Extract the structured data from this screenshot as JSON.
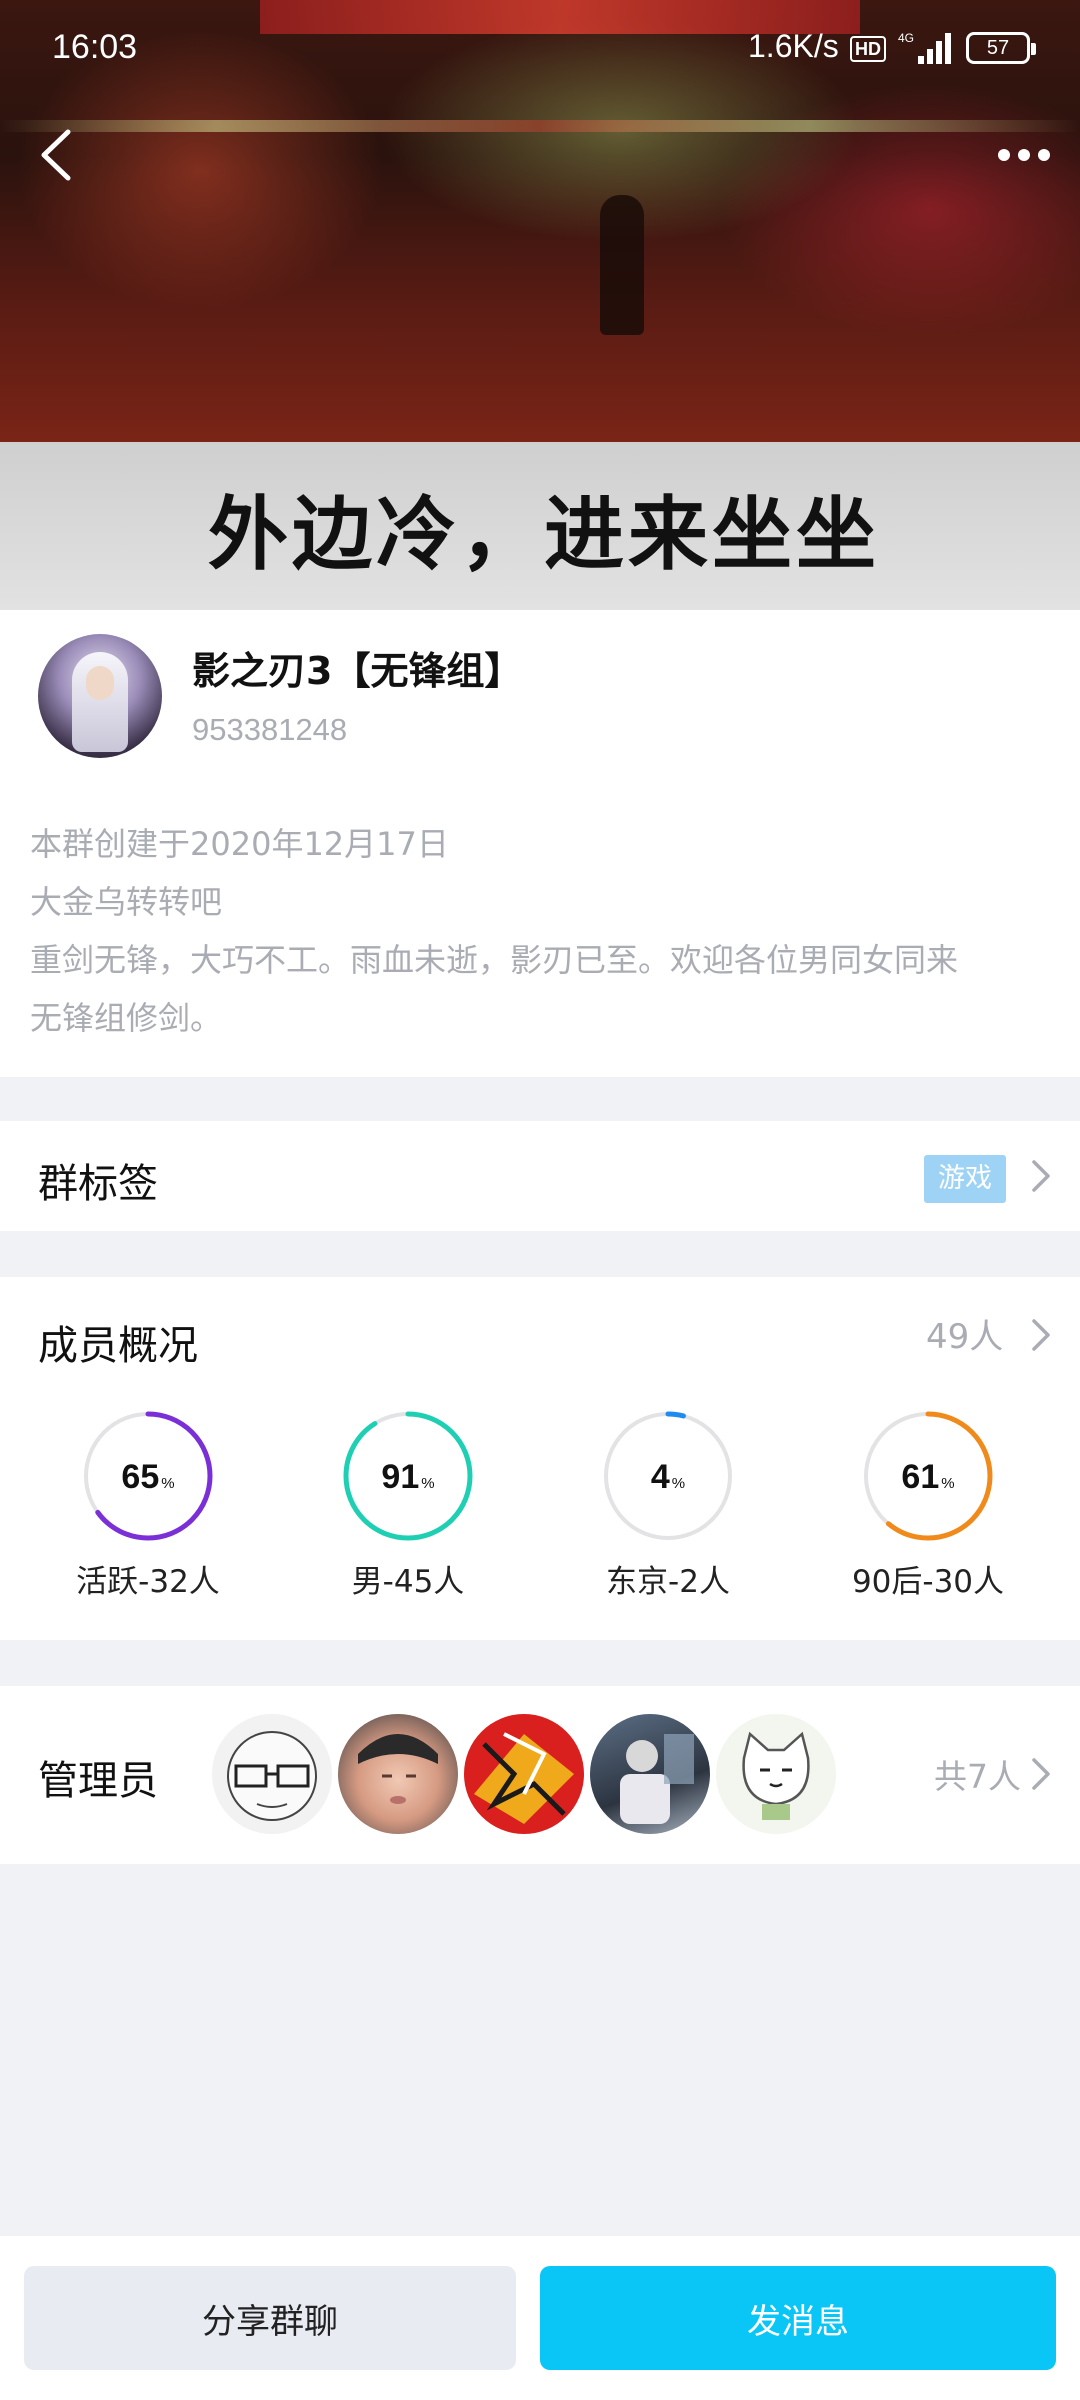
{
  "status_bar": {
    "time": "16:03",
    "net_speed": "1.6K/s",
    "hd_badge": "HD",
    "network_type": "4G",
    "battery": "57"
  },
  "banner": {
    "caption": "外边冷，进来坐坐"
  },
  "group": {
    "name": "影之刃3【无锋组】",
    "id": "953381248",
    "description_lines": [
      "本群创建于2020年12月17日",
      "大金乌转转吧",
      "重剑无锋，大巧不工。雨血未逝，影刃已至。欢迎各位男同女同来",
      "无锋组修剑。"
    ]
  },
  "tags": {
    "title": "群标签",
    "tag": "游戏"
  },
  "members": {
    "title": "成员概况",
    "count": "49人",
    "stats": [
      {
        "value": "65",
        "percent_sign": "%",
        "fraction": 0.65,
        "label": "活跃-32人",
        "color": "#7b2fd6"
      },
      {
        "value": "91",
        "percent_sign": "%",
        "fraction": 0.91,
        "label": "男-45人",
        "color": "#1fcfb3"
      },
      {
        "value": "4",
        "percent_sign": "%",
        "fraction": 0.04,
        "label": "东京-2人",
        "color": "#1f8bf0"
      },
      {
        "value": "61",
        "percent_sign": "%",
        "fraction": 0.61,
        "label": "90后-30人",
        "color": "#f08a1a"
      }
    ]
  },
  "admins": {
    "title": "管理员",
    "total": "共7人",
    "avatars": [
      "glasses-face-avatar",
      "baby-photo-avatar",
      "red-pattern-avatar",
      "blue-photo-avatar",
      "cartoon-cat-avatar"
    ]
  },
  "actions": {
    "share_label": "分享群聊",
    "send_label": "发消息"
  },
  "colors": {
    "ring_track": "#e3e3e6",
    "tag_bg": "#9ed3f5",
    "send_button": "#0ac6f6",
    "page_bg": "#f1f2f6"
  }
}
